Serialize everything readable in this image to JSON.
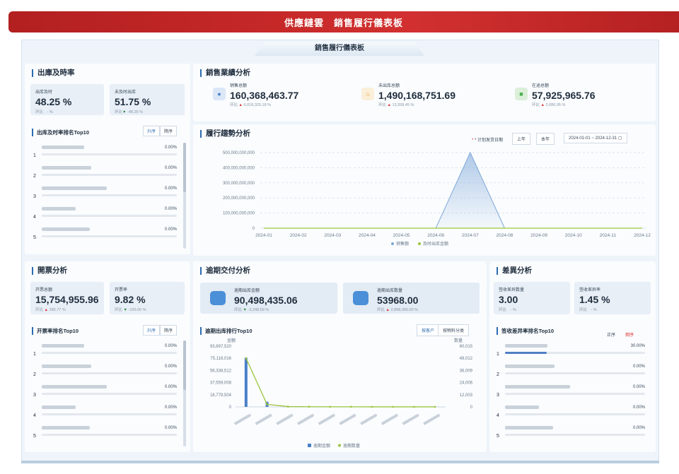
{
  "app_title": "供應鏈雲　銷售履行儀表板",
  "dashboard_tab": "銷售履行儀表板",
  "delivery_rate": {
    "title": "出庫及時率",
    "kpis": [
      {
        "label": "出库及时",
        "value": "48.25 %",
        "compare_label": "环比",
        "compare": "- %"
      },
      {
        "label": "未及时出库",
        "value": "51.75 %",
        "compare_label": "环比",
        "compare": "-48.25 %"
      }
    ],
    "rank_title": "出库及时率排名Top10",
    "sort_asc": "升序",
    "sort_desc": "降序",
    "ranks": [
      {
        "num": "1",
        "pct": "0.00%"
      },
      {
        "num": "2",
        "pct": "0.00%"
      },
      {
        "num": "3",
        "pct": "0.00%"
      },
      {
        "num": "4",
        "pct": "0.00%"
      },
      {
        "num": "5",
        "pct": "0.00%"
      }
    ]
  },
  "sales": {
    "title": "銷售業績分析",
    "kpis": [
      {
        "label": "销售总额",
        "value": "160,368,463.77",
        "compare_label": "环比",
        "compare": "6,018,325.18 %",
        "icon": "user-icon",
        "color": "#4a7fc8",
        "bg": "#dbe7f6"
      },
      {
        "label": "未出库总额",
        "value": "1,490,168,751.69",
        "compare_label": "环比",
        "compare": "13,358.45 %",
        "icon": "home-icon",
        "color": "#e6a23c",
        "bg": "#fbefd9"
      },
      {
        "label": "在途总额",
        "value": "57,925,965.76",
        "compare_label": "环比",
        "compare": "2,686.95 %",
        "icon": "truck-icon",
        "color": "#4caf50",
        "bg": "#dcefd9"
      }
    ]
  },
  "trend": {
    "title": "履行趨勢分析",
    "filter_label": "* 计划发货日期",
    "btn_prev": "上年",
    "btn_year": "本年",
    "date_range": "2024-01-01 ~ 2024-12-31",
    "legend": [
      "销售额",
      "及时出库金额"
    ]
  },
  "invoice": {
    "title": "開票分析",
    "kpis": [
      {
        "label": "开票总额",
        "value": "15,754,955.96",
        "compare_label": "环比",
        "compare": "285.77 %",
        "dir": "up"
      },
      {
        "label": "开票率",
        "value": "9.82 %",
        "compare_label": "环比",
        "compare": "-100.00 %",
        "dir": "down"
      }
    ],
    "rank_title": "开票率排名Top10",
    "sort_asc": "升序",
    "sort_desc": "降序",
    "ranks": [
      {
        "num": "1",
        "pct": "0.00%"
      },
      {
        "num": "2",
        "pct": "0.00%"
      },
      {
        "num": "3",
        "pct": "0.00%"
      },
      {
        "num": "4",
        "pct": "0.00%"
      },
      {
        "num": "5",
        "pct": "0.00%"
      }
    ]
  },
  "overdue": {
    "title": "逾期交付分析",
    "kpis": [
      {
        "label": "逾期出库金额",
        "value": "90,498,435.06",
        "compare_label": "环比",
        "compare": "-3,248.59 %",
        "dir": "down"
      },
      {
        "label": "逾期出库数量",
        "value": "53968.00",
        "compare_label": "环比",
        "compare": "2,898,300.00 %",
        "dir": "up"
      }
    ],
    "rank_title": "逾期出库排行Top10",
    "btn_customer": "按客户",
    "btn_material": "按物料分类",
    "y_left_title": "金额",
    "y_right_title": "数量",
    "legend": [
      "逾期金额",
      "逾期数量"
    ]
  },
  "variance": {
    "title": "差異分析",
    "kpis": [
      {
        "label": "签收差异数量",
        "value": "3.00",
        "compare_label": "环比",
        "compare": "- %"
      },
      {
        "label": "签收差异率",
        "value": "1.45 %",
        "compare_label": "环比",
        "compare": "- %"
      }
    ],
    "rank_title": "签收差异率排名Top10",
    "sort_asc": "正序",
    "sort_desc": "倒序",
    "ranks": [
      {
        "num": "1",
        "pct": "30.00%",
        "fill": 0.3
      },
      {
        "num": "2",
        "pct": "0.00%"
      },
      {
        "num": "3",
        "pct": "0.00%"
      },
      {
        "num": "4",
        "pct": "0.00%"
      },
      {
        "num": "5",
        "pct": "0.00%"
      }
    ]
  },
  "chart_data": [
    {
      "type": "area",
      "x": [
        "2024-01",
        "2024-02",
        "2024-03",
        "2024-04",
        "2024-05",
        "2024-06",
        "2024-07",
        "2024-08",
        "2024-09",
        "2024-10",
        "2024-11",
        "2024-12"
      ],
      "ylim": [
        0,
        500000000000
      ],
      "yticks": [
        "0",
        "100,000,000,000",
        "200,000,000,000",
        "300,000,000,000",
        "400,000,000,000",
        "500,000,000,000"
      ],
      "series": [
        {
          "name": "销售额",
          "values": [
            0,
            0,
            0,
            0,
            0,
            0,
            500000000000,
            0,
            0,
            0,
            0,
            0
          ],
          "color": "#7ea8d8"
        },
        {
          "name": "及时出库金额",
          "values": [
            0,
            0,
            0,
            0,
            0,
            0,
            0,
            0,
            0,
            0,
            0,
            0
          ],
          "color": "#9bc53d"
        }
      ],
      "grid": true,
      "legend_position": "bottom"
    },
    {
      "type": "bar",
      "categories_count": 10,
      "yticks_left": [
        "0",
        "18,779,504",
        "37,559,008",
        "56,338,512",
        "75,118,016",
        "93,897,520"
      ],
      "yticks_right": [
        "0",
        "12,003",
        "24,006",
        "36,009",
        "48,012",
        "60,015"
      ],
      "series": [
        {
          "name": "逾期金额",
          "type": "bar",
          "values": [
            76000000,
            8000000,
            0,
            0,
            0,
            0,
            0,
            0,
            0,
            0
          ],
          "color": "#4a7fc8"
        },
        {
          "name": "逾期数量",
          "type": "line",
          "values": [
            48000,
            2500,
            300,
            200,
            100,
            100,
            50,
            50,
            50,
            50
          ],
          "color": "#9bc53d"
        }
      ],
      "legend_position": "bottom"
    }
  ]
}
